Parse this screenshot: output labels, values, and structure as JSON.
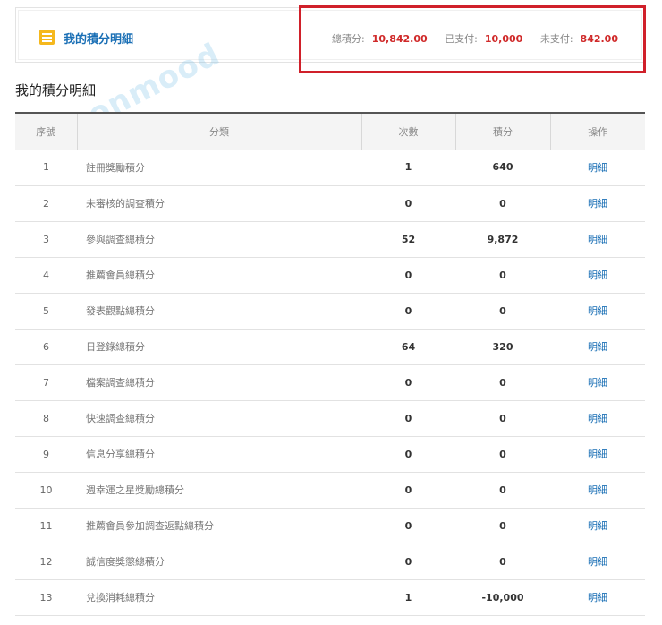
{
  "summary": {
    "title": "我的積分明細",
    "total_label": "總積分:",
    "total_value": "10,842.00",
    "paid_label": "已支付:",
    "paid_value": "10,000",
    "unpaid_label": "未支付:",
    "unpaid_value": "842.00"
  },
  "watermark": "Moonmood",
  "section_title": "我的積分明細",
  "table": {
    "headers": [
      "序號",
      "分類",
      "次數",
      "積分",
      "操作"
    ],
    "rows": [
      {
        "idx": "1",
        "category": "註冊獎勵積分",
        "count": "1",
        "points": "640",
        "action": "明細"
      },
      {
        "idx": "2",
        "category": "未審核的調查積分",
        "count": "0",
        "points": "0",
        "action": "明細"
      },
      {
        "idx": "3",
        "category": "參與調查總積分",
        "count": "52",
        "points": "9,872",
        "action": "明細"
      },
      {
        "idx": "4",
        "category": "推薦會員總積分",
        "count": "0",
        "points": "0",
        "action": "明細"
      },
      {
        "idx": "5",
        "category": "發表觀點總積分",
        "count": "0",
        "points": "0",
        "action": "明細"
      },
      {
        "idx": "6",
        "category": "日登錄總積分",
        "count": "64",
        "points": "320",
        "action": "明細"
      },
      {
        "idx": "7",
        "category": "檔案調查總積分",
        "count": "0",
        "points": "0",
        "action": "明細"
      },
      {
        "idx": "8",
        "category": "快速調查總積分",
        "count": "0",
        "points": "0",
        "action": "明細"
      },
      {
        "idx": "9",
        "category": "信息分享總積分",
        "count": "0",
        "points": "0",
        "action": "明細"
      },
      {
        "idx": "10",
        "category": "週幸運之星獎勵總積分",
        "count": "0",
        "points": "0",
        "action": "明細"
      },
      {
        "idx": "11",
        "category": "推薦會員參加調查返點總積分",
        "count": "0",
        "points": "0",
        "action": "明細"
      },
      {
        "idx": "12",
        "category": "誠信度獎懲總積分",
        "count": "0",
        "points": "0",
        "action": "明細"
      },
      {
        "idx": "13",
        "category": "兌換消耗總積分",
        "count": "1",
        "points": "-10,000",
        "action": "明細"
      }
    ]
  },
  "colors": {
    "accent": "#1a6fb5",
    "highlight": "#d0202a",
    "stat_value": "#d02a2a",
    "icon": "#f5b81d"
  }
}
